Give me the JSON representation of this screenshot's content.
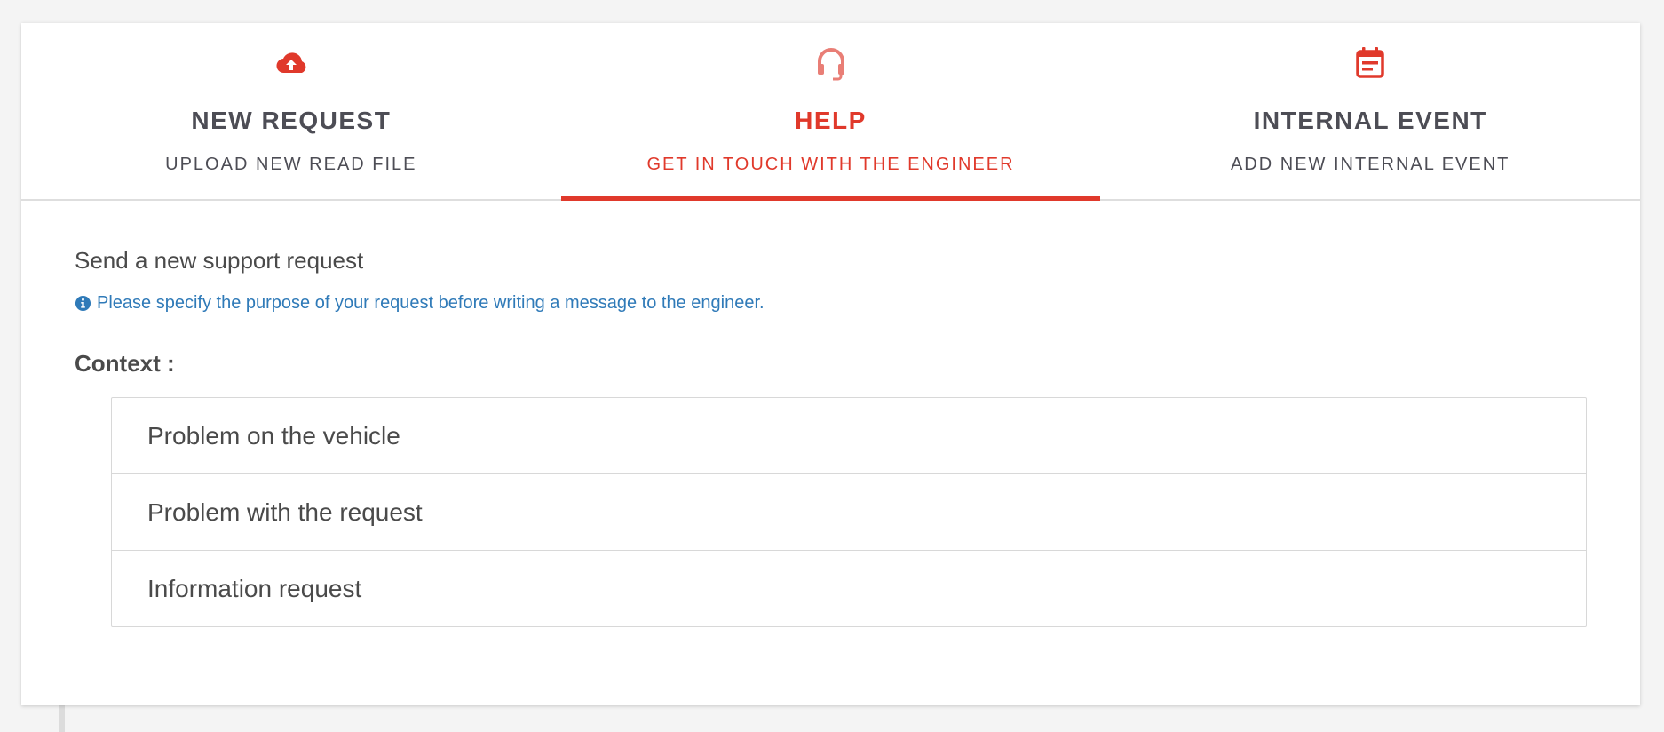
{
  "tabs": [
    {
      "title": "NEW REQUEST",
      "subtitle": "UPLOAD NEW READ FILE",
      "icon": "cloud-upload-icon",
      "active": false
    },
    {
      "title": "HELP",
      "subtitle": "GET IN TOUCH WITH THE ENGINEER",
      "icon": "headset-icon",
      "active": true
    },
    {
      "title": "INTERNAL EVENT",
      "subtitle": "ADD NEW INTERNAL EVENT",
      "icon": "calendar-icon",
      "active": false
    }
  ],
  "main": {
    "title": "Send a new support request",
    "hint": "Please specify the purpose of your request before writing a message to the engineer.",
    "hint_icon": "info-circle-icon",
    "context_label": "Context :",
    "options": [
      {
        "label": "Problem on the vehicle"
      },
      {
        "label": "Problem with the request"
      },
      {
        "label": "Information request"
      }
    ]
  },
  "colors": {
    "accent": "#e0392b",
    "accent_light": "#e97e76",
    "info": "#2f7ab8",
    "text": "#4a4a4a"
  }
}
